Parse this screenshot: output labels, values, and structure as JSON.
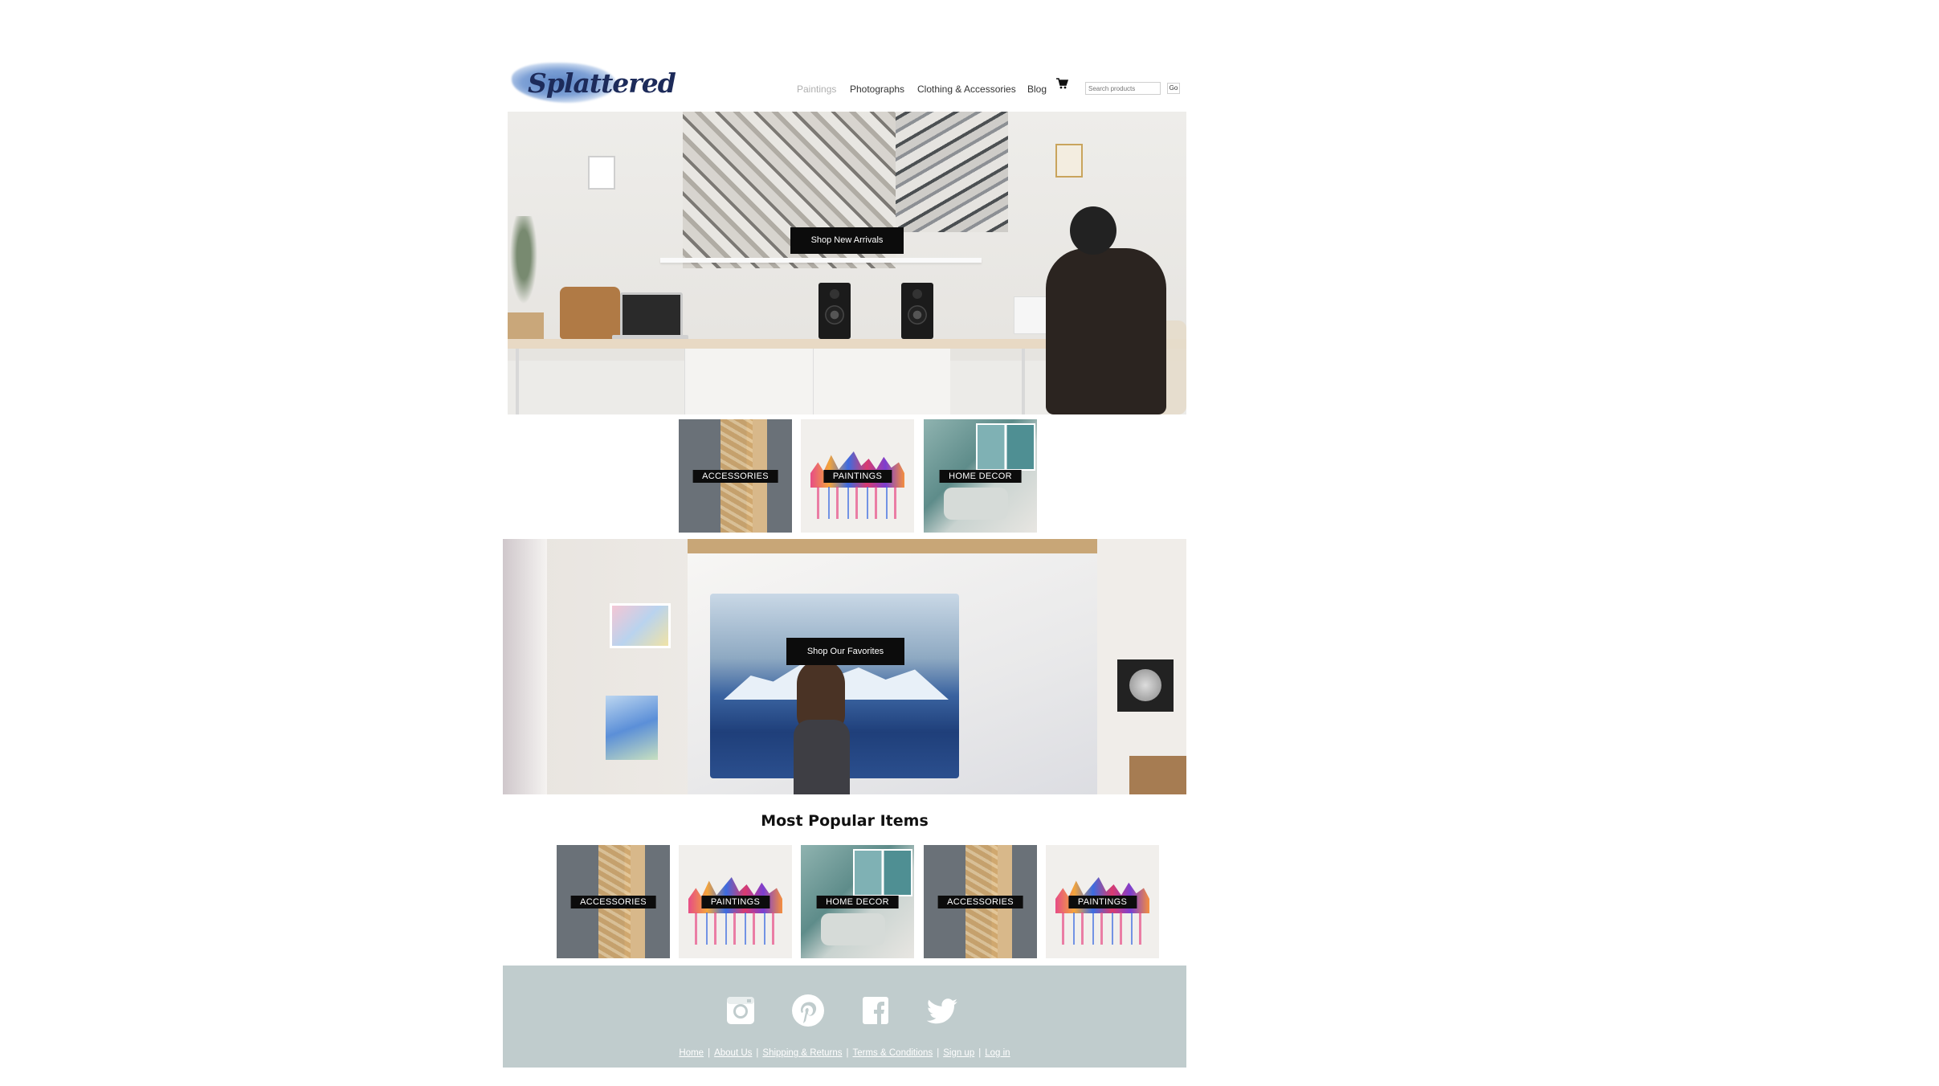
{
  "brand": {
    "logo_text": "Splattered"
  },
  "nav": {
    "items": [
      {
        "label": "Paintings",
        "state": "dim"
      },
      {
        "label": "Photographs",
        "state": "normal"
      },
      {
        "label": "Clothing & Accessories",
        "state": "normal"
      },
      {
        "label": "Blog",
        "state": "normal"
      }
    ],
    "cart_icon": "shopping-cart-icon",
    "search": {
      "placeholder": "Search products",
      "button_label": "Go"
    }
  },
  "hero1": {
    "cta_label": "Shop New Arrivals"
  },
  "categories": [
    {
      "label": "ACCESSORIES"
    },
    {
      "label": "PAINTINGS"
    },
    {
      "label": "HOME DECOR"
    }
  ],
  "hero2": {
    "cta_label": "Shop Our Favorites"
  },
  "popular": {
    "title": "Most Popular Items",
    "items": [
      {
        "label": "ACCESSORIES"
      },
      {
        "label": "PAINTINGS"
      },
      {
        "label": "HOME DECOR"
      },
      {
        "label": "ACCESSORIES"
      },
      {
        "label": "PAINTINGS"
      }
    ]
  },
  "footer": {
    "social": [
      "instagram-icon",
      "pinterest-icon",
      "facebook-icon",
      "twitter-icon"
    ],
    "links": [
      "Home",
      "About Us",
      "Shipping & Returns",
      "Terms & Conditions",
      "Sign up",
      "Log in"
    ],
    "separator": "|"
  },
  "colors": {
    "footer_bg": "#c0cccd",
    "cta_bg": "#0c0c0c",
    "nav_dim": "#b0b0b0",
    "logo_blue": "#1d2b5a"
  }
}
